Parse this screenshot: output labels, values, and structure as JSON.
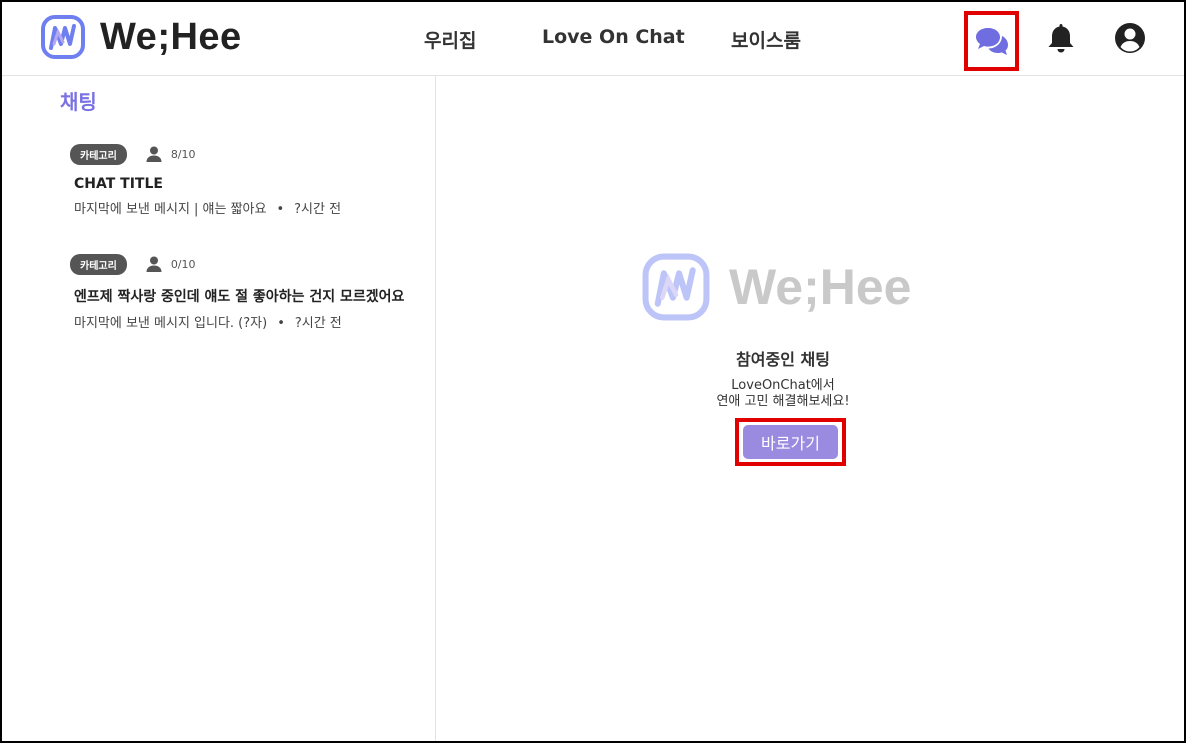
{
  "brand": {
    "name": "We;Hee",
    "accent": "#7a72e3",
    "mark_colors": [
      "#6f7ff0",
      "#9a8be0"
    ]
  },
  "nav": {
    "items": [
      "우리집",
      "Love On Chat",
      "보이스룸"
    ]
  },
  "header_icons": {
    "chat": "chat-bubbles-icon",
    "notifications": "bell-icon",
    "profile": "user-circle-icon"
  },
  "sidebar": {
    "title": "채팅",
    "chats": [
      {
        "category": "카테고리",
        "members": "8/10",
        "title": "CHAT TITLE",
        "last_message": "마지막에 보낸 메시지 |  얘는 짧아요",
        "time": "?시간 전"
      },
      {
        "category": "카테고리",
        "members": "0/10",
        "title": "엔프제 짝사랑 중인데 얘도 절 좋아하는 건지 모르겠어요",
        "last_message": "마지막에 보낸 메시지 입니다. (?자)",
        "time": "?시간 전"
      }
    ],
    "separator": "•"
  },
  "main": {
    "brand_text": "We;Hee",
    "empty_title": "참여중인 채팅",
    "empty_desc_line1": "LoveOnChat에서",
    "empty_desc_line2": "연애 고민 해결해보세요!",
    "go_button": "바로가기"
  },
  "highlight_color": "#e00000"
}
